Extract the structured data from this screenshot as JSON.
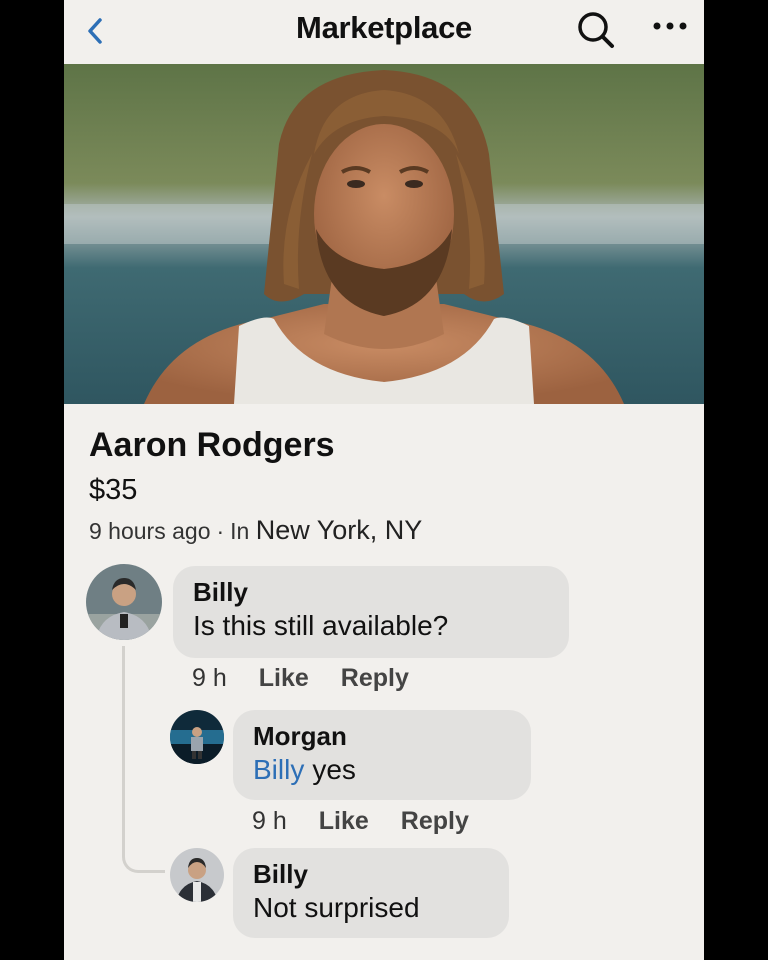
{
  "header": {
    "title": "Marketplace",
    "back_icon": "chevron-left-icon",
    "search_icon": "search-icon",
    "more_icon": "more-horizontal-icon",
    "accent_color": "#2d6fb6"
  },
  "listing": {
    "title": "Aaron Rodgers",
    "price": "$35",
    "time": "9 hours ago",
    "separator": "·",
    "location_prefix": "In",
    "location": "New York, NY"
  },
  "comments": [
    {
      "author": "Billy",
      "text": "Is this still available?",
      "time": "9 h",
      "like_label": "Like",
      "reply_label": "Reply"
    },
    {
      "author": "Morgan",
      "mention": "Billy",
      "text": "yes",
      "time": "9 h",
      "like_label": "Like",
      "reply_label": "Reply"
    },
    {
      "author": "Billy",
      "text": "Not surprised"
    }
  ]
}
